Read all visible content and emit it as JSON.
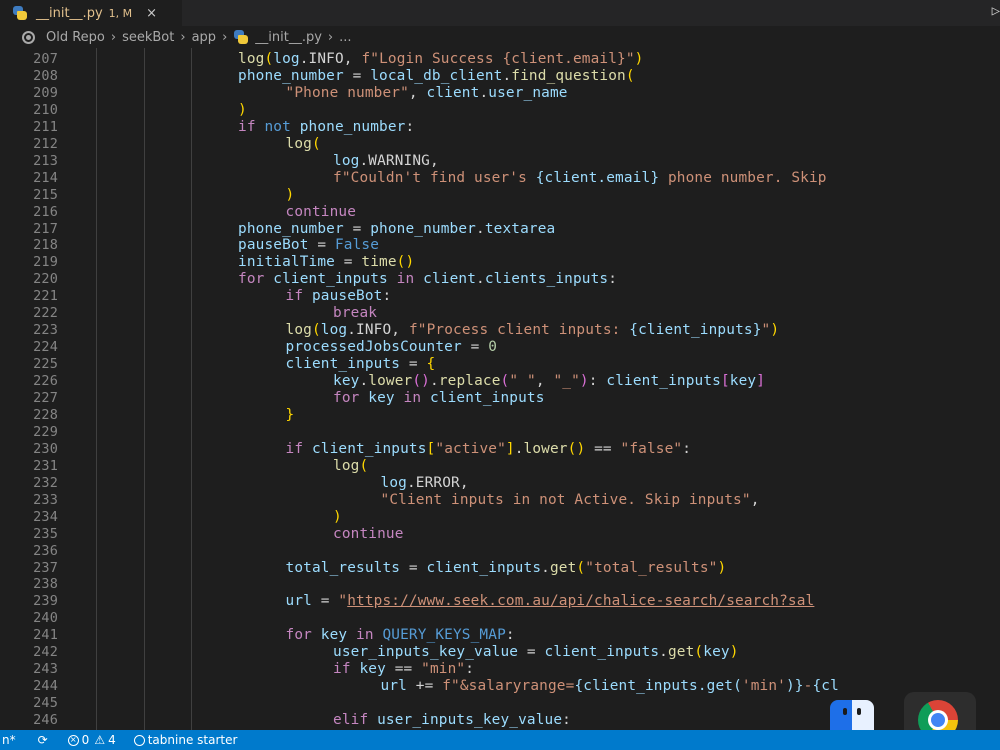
{
  "tab": {
    "label": "__init__.py",
    "badge": "1, M",
    "close": "×"
  },
  "breadcrumb": [
    "Old Repo",
    "seekBot",
    "app",
    "__init__.py",
    "..."
  ],
  "editor": {
    "lines": [
      {
        "n": "207",
        "i": 0,
        "t": [
          [
            "log",
            "fn"
          ],
          [
            "(",
            "p1"
          ],
          [
            "log",
            "var"
          ],
          [
            ".INFO, ",
            "text"
          ],
          [
            "f\"Login Success {client.email}\"",
            "str"
          ],
          [
            ")",
            "p1"
          ]
        ]
      },
      {
        "n": "208",
        "i": 0,
        "t": [
          [
            "phone_number",
            "var"
          ],
          [
            " = ",
            "text"
          ],
          [
            "local_db_client",
            "var"
          ],
          [
            ".",
            "text"
          ],
          [
            "find_question",
            "fn"
          ],
          [
            "(",
            "p1"
          ]
        ]
      },
      {
        "n": "209",
        "i": 1,
        "t": [
          [
            "\"Phone number\"",
            "str"
          ],
          [
            ", ",
            "text"
          ],
          [
            "client",
            "var"
          ],
          [
            ".",
            "text"
          ],
          [
            "user_name",
            "var"
          ]
        ]
      },
      {
        "n": "210",
        "i": 0,
        "t": [
          [
            ")",
            "p1"
          ]
        ]
      },
      {
        "n": "211",
        "i": 0,
        "t": [
          [
            "if ",
            "kw"
          ],
          [
            "not ",
            "const"
          ],
          [
            "phone_number",
            "var"
          ],
          [
            ":",
            "text"
          ]
        ]
      },
      {
        "n": "212",
        "i": 1,
        "t": [
          [
            "log",
            "fn"
          ],
          [
            "(",
            "p1"
          ]
        ]
      },
      {
        "n": "213",
        "i": 2,
        "t": [
          [
            "log",
            "var"
          ],
          [
            ".WARNING,",
            "text"
          ]
        ]
      },
      {
        "n": "214",
        "i": 2,
        "t": [
          [
            "f\"Couldn't find user's ",
            "str"
          ],
          [
            "{client.email}",
            "var"
          ],
          [
            " phone number. Skip",
            "str"
          ]
        ]
      },
      {
        "n": "215",
        "i": 1,
        "t": [
          [
            ")",
            "p1"
          ]
        ]
      },
      {
        "n": "216",
        "i": 1,
        "t": [
          [
            "continue",
            "kw"
          ]
        ]
      },
      {
        "n": "217",
        "i": 0,
        "t": [
          [
            "phone_number",
            "var"
          ],
          [
            " = ",
            "text"
          ],
          [
            "phone_number",
            "var"
          ],
          [
            ".",
            "text"
          ],
          [
            "textarea",
            "var"
          ]
        ]
      },
      {
        "n": "218",
        "i": 0,
        "t": [
          [
            "pauseBot",
            "var"
          ],
          [
            " = ",
            "text"
          ],
          [
            "False",
            "const"
          ]
        ]
      },
      {
        "n": "219",
        "i": 0,
        "t": [
          [
            "initialTime",
            "var"
          ],
          [
            " = ",
            "text"
          ],
          [
            "time",
            "fn"
          ],
          [
            "()",
            "p1"
          ]
        ]
      },
      {
        "n": "220",
        "i": 0,
        "t": [
          [
            "for ",
            "kw"
          ],
          [
            "client_inputs",
            "var"
          ],
          [
            " in ",
            "kw"
          ],
          [
            "client",
            "var"
          ],
          [
            ".",
            "text"
          ],
          [
            "clients_inputs",
            "var"
          ],
          [
            ":",
            "text"
          ]
        ]
      },
      {
        "n": "221",
        "i": 1,
        "t": [
          [
            "if ",
            "kw"
          ],
          [
            "pauseBot",
            "var"
          ],
          [
            ":",
            "text"
          ]
        ]
      },
      {
        "n": "222",
        "i": 2,
        "t": [
          [
            "break",
            "kw"
          ]
        ]
      },
      {
        "n": "223",
        "i": 1,
        "t": [
          [
            "log",
            "fn"
          ],
          [
            "(",
            "p1"
          ],
          [
            "log",
            "var"
          ],
          [
            ".INFO, ",
            "text"
          ],
          [
            "f\"Process client inputs: ",
            "str"
          ],
          [
            "{client_inputs}",
            "var"
          ],
          [
            "\"",
            "str"
          ],
          [
            ")",
            "p1"
          ]
        ]
      },
      {
        "n": "224",
        "i": 1,
        "t": [
          [
            "processedJobsCounter",
            "var"
          ],
          [
            " = ",
            "text"
          ],
          [
            "0",
            "num"
          ]
        ]
      },
      {
        "n": "225",
        "i": 1,
        "t": [
          [
            "client_inputs",
            "var"
          ],
          [
            " = ",
            "text"
          ],
          [
            "{",
            "p1"
          ]
        ]
      },
      {
        "n": "226",
        "i": 2,
        "t": [
          [
            "key",
            "var"
          ],
          [
            ".",
            "text"
          ],
          [
            "lower",
            "fn"
          ],
          [
            "()",
            "p2"
          ],
          [
            ".",
            "text"
          ],
          [
            "replace",
            "fn"
          ],
          [
            "(",
            "p2"
          ],
          [
            "\" \"",
            "str"
          ],
          [
            ", ",
            "text"
          ],
          [
            "\"_\"",
            "str"
          ],
          [
            ")",
            "p2"
          ],
          [
            ": ",
            "text"
          ],
          [
            "client_inputs",
            "var"
          ],
          [
            "[",
            "p2"
          ],
          [
            "key",
            "var"
          ],
          [
            "]",
            "p2"
          ]
        ]
      },
      {
        "n": "227",
        "i": 2,
        "t": [
          [
            "for ",
            "kw"
          ],
          [
            "key",
            "var"
          ],
          [
            " in ",
            "kw"
          ],
          [
            "client_inputs",
            "var"
          ]
        ]
      },
      {
        "n": "228",
        "i": 1,
        "t": [
          [
            "}",
            "p1"
          ]
        ]
      },
      {
        "n": "229",
        "i": 0,
        "t": []
      },
      {
        "n": "230",
        "i": 1,
        "t": [
          [
            "if ",
            "kw"
          ],
          [
            "client_inputs",
            "var"
          ],
          [
            "[",
            "p1"
          ],
          [
            "\"active\"",
            "str"
          ],
          [
            "]",
            "p1"
          ],
          [
            ".",
            "text"
          ],
          [
            "lower",
            "fn"
          ],
          [
            "()",
            "p1"
          ],
          [
            " == ",
            "text"
          ],
          [
            "\"false\"",
            "str"
          ],
          [
            ":",
            "text"
          ]
        ]
      },
      {
        "n": "231",
        "i": 2,
        "t": [
          [
            "log",
            "fn"
          ],
          [
            "(",
            "p1"
          ]
        ]
      },
      {
        "n": "232",
        "i": 3,
        "t": [
          [
            "log",
            "var"
          ],
          [
            ".ERROR,",
            "text"
          ]
        ]
      },
      {
        "n": "233",
        "i": 3,
        "t": [
          [
            "\"Client inputs in not Active. Skip inputs\"",
            "str"
          ],
          [
            ",",
            "text"
          ]
        ]
      },
      {
        "n": "234",
        "i": 2,
        "t": [
          [
            ")",
            "p1"
          ]
        ]
      },
      {
        "n": "235",
        "i": 2,
        "t": [
          [
            "continue",
            "kw"
          ]
        ]
      },
      {
        "n": "236",
        "i": 0,
        "t": []
      },
      {
        "n": "237",
        "i": 1,
        "t": [
          [
            "total_results",
            "var"
          ],
          [
            " = ",
            "text"
          ],
          [
            "client_inputs",
            "var"
          ],
          [
            ".",
            "text"
          ],
          [
            "get",
            "fn"
          ],
          [
            "(",
            "p1"
          ],
          [
            "\"total_results\"",
            "str"
          ],
          [
            ")",
            "p1"
          ]
        ]
      },
      {
        "n": "238",
        "i": 0,
        "t": []
      },
      {
        "n": "239",
        "i": 1,
        "t": [
          [
            "url",
            "var"
          ],
          [
            " = ",
            "text"
          ],
          [
            "\"",
            "str"
          ],
          [
            "https://www.seek.com.au/api/chalice-search/search?sal",
            "url"
          ]
        ]
      },
      {
        "n": "240",
        "i": 0,
        "t": []
      },
      {
        "n": "241",
        "i": 1,
        "t": [
          [
            "for ",
            "kw"
          ],
          [
            "key",
            "var"
          ],
          [
            " in ",
            "kw"
          ],
          [
            "QUERY_KEYS_MAP",
            "const"
          ],
          [
            ":",
            "text"
          ]
        ]
      },
      {
        "n": "242",
        "i": 2,
        "t": [
          [
            "user_inputs_key_value",
            "var"
          ],
          [
            " = ",
            "text"
          ],
          [
            "client_inputs",
            "var"
          ],
          [
            ".",
            "text"
          ],
          [
            "get",
            "fn"
          ],
          [
            "(",
            "p1"
          ],
          [
            "key",
            "var"
          ],
          [
            ")",
            "p1"
          ]
        ]
      },
      {
        "n": "243",
        "i": 2,
        "t": [
          [
            "if ",
            "kw"
          ],
          [
            "key",
            "var"
          ],
          [
            " == ",
            "text"
          ],
          [
            "\"min\"",
            "str"
          ],
          [
            ":",
            "text"
          ]
        ]
      },
      {
        "n": "244",
        "i": 3,
        "t": [
          [
            "url",
            "var"
          ],
          [
            " += ",
            "text"
          ],
          [
            "f\"&salaryrange=",
            "str"
          ],
          [
            "{client_inputs.get(",
            "var"
          ],
          [
            "'min'",
            "str"
          ],
          [
            ")}",
            "var"
          ],
          [
            "-",
            "str"
          ],
          [
            "{cl",
            "var"
          ]
        ]
      },
      {
        "n": "245",
        "i": 0,
        "t": []
      },
      {
        "n": "246",
        "i": 2,
        "t": [
          [
            "elif ",
            "kw"
          ],
          [
            "user_inputs_key_value",
            "var"
          ],
          [
            ":",
            "text"
          ]
        ]
      }
    ]
  },
  "status": {
    "branch": "n*",
    "errors": "0",
    "warnings": "4",
    "tabnine": "tabnine starter"
  },
  "icons": {
    "python": "python-file-icon",
    "finder": "finder-icon",
    "chrome": "chrome-icon"
  }
}
